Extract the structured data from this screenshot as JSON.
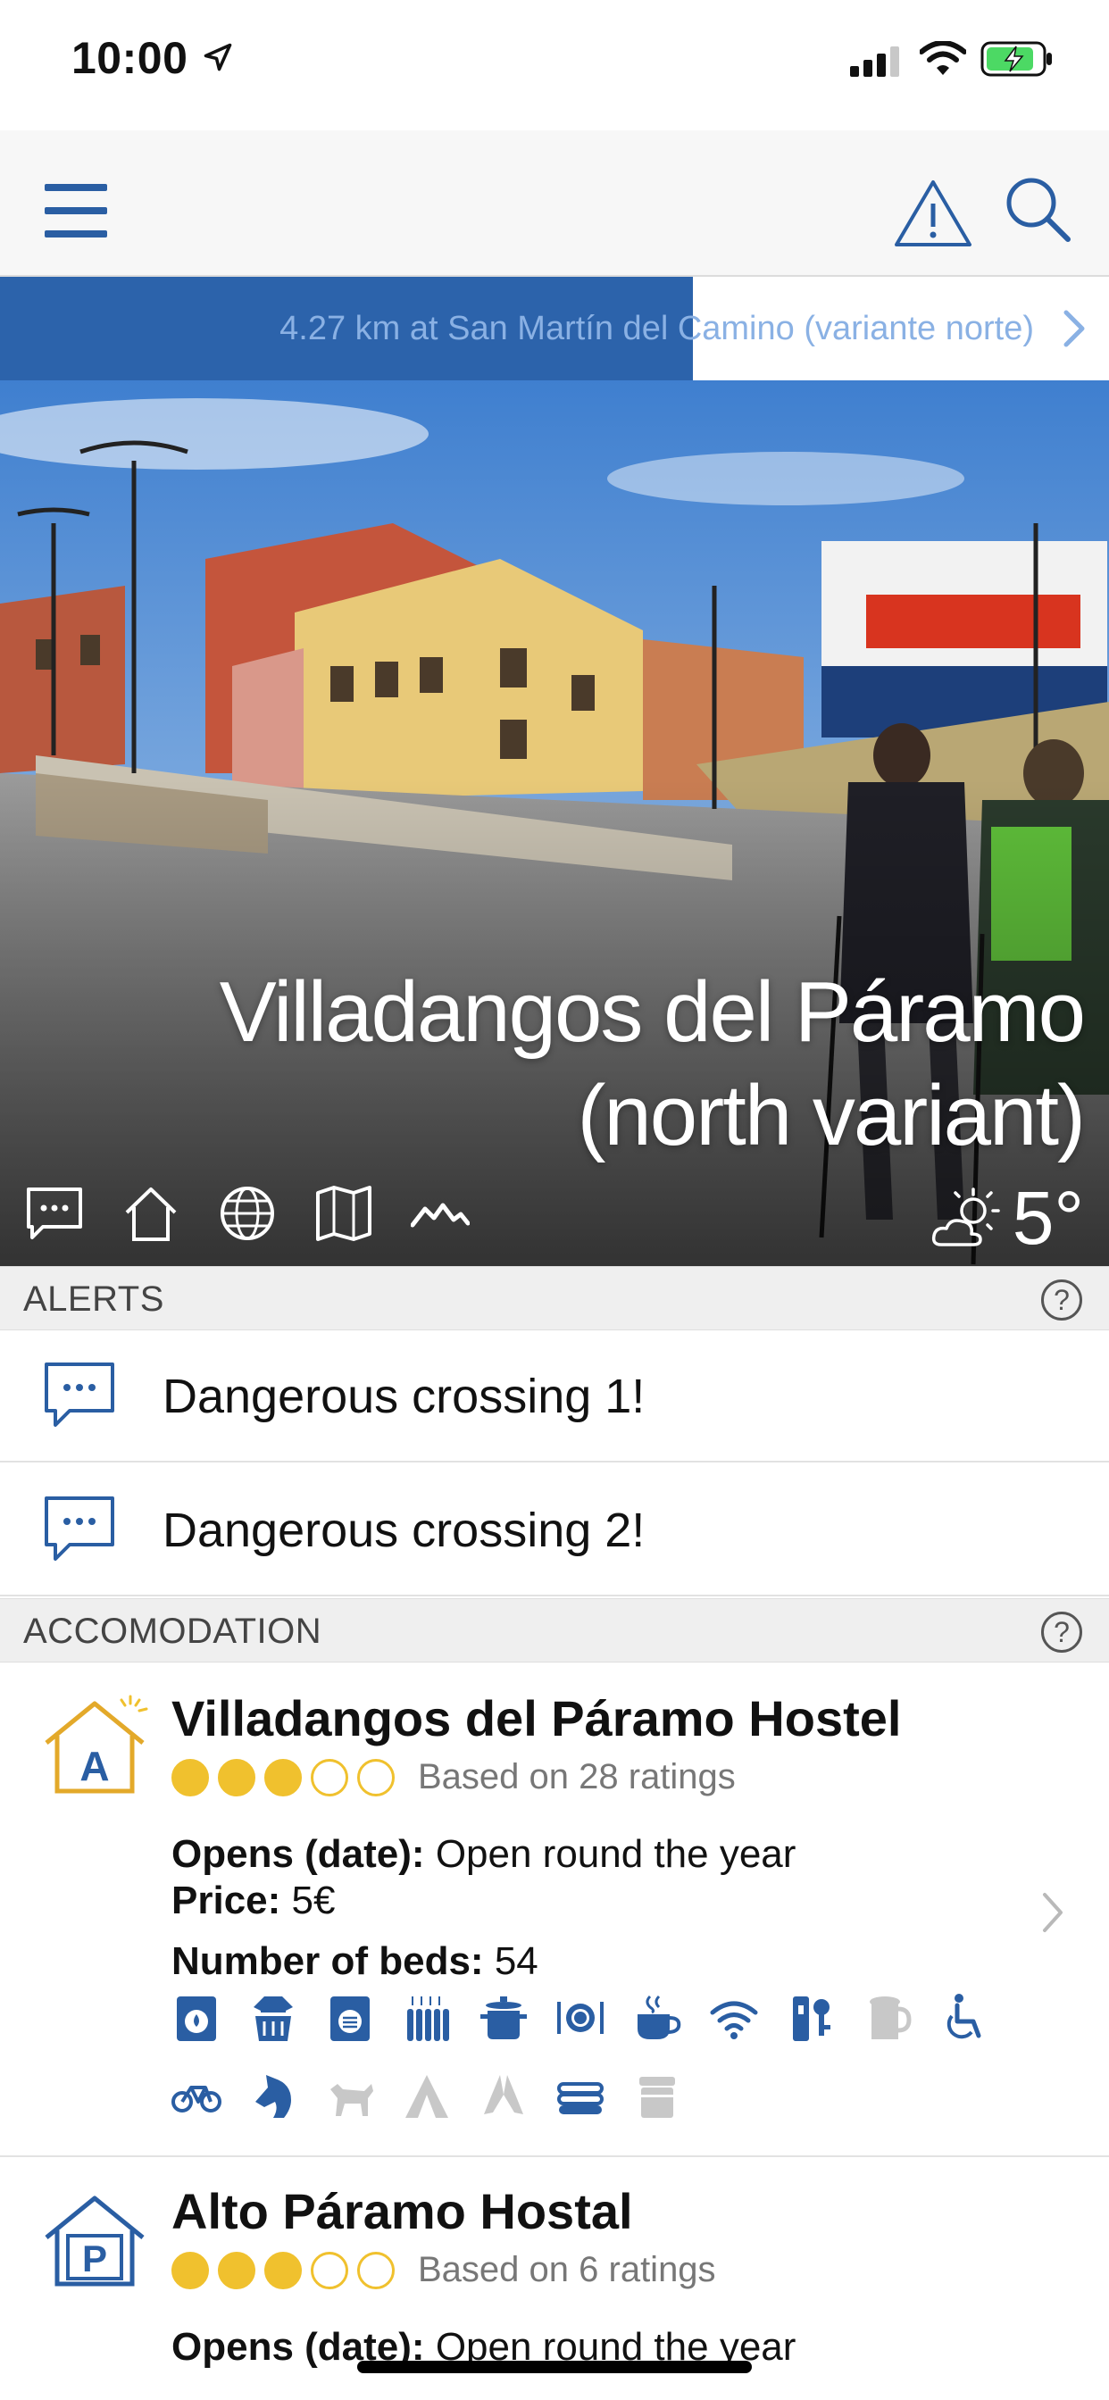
{
  "status_bar": {
    "time": "10:00"
  },
  "header": {
    "menu_icon": "hamburger-menu-icon",
    "alert_icon": "warning-triangle-icon",
    "search_icon": "search-icon"
  },
  "progress": {
    "text": "4.27 km at San Martín del Camino (variante norte)",
    "fill_fraction": 0.625,
    "colors": {
      "fill": "#2c63ab",
      "text": "#8ab1e4"
    }
  },
  "hero": {
    "title_line1": "Villadangos del Páramo",
    "title_line2": "(north variant)",
    "temperature": "5°",
    "weather_icon": "partly-sunny-icon",
    "icons": [
      "comments-icon",
      "home-icon",
      "globe-icon",
      "map-icon",
      "elevation-icon"
    ]
  },
  "alerts": {
    "title": "ALERTS",
    "help": "?",
    "items": [
      {
        "text": "Dangerous crossing 1!"
      },
      {
        "text": "Dangerous crossing 2!"
      }
    ]
  },
  "accommodation": {
    "title": "ACCOMODATION",
    "help": "?",
    "items": [
      {
        "name": "Villadangos del Páramo Hostel",
        "rating": 3,
        "rating_max": 5,
        "rating_text": "Based on 28 ratings",
        "opens_label": "Opens (date):",
        "opens_value": "Open round the year",
        "price_label": "Price:",
        "price_value": "5€",
        "beds_label": "Number of beds:",
        "beds_value": "54",
        "badge": "A"
      },
      {
        "name": "Alto Páramo Hostal",
        "rating": 3,
        "rating_max": 5,
        "rating_text": "Based on 6 ratings",
        "opens_label": "Opens (date):",
        "opens_value": "Open round the year",
        "badge": "P"
      }
    ]
  },
  "colors": {
    "brand_blue": "#2a5ea3",
    "star_yellow": "#f0c12e"
  }
}
